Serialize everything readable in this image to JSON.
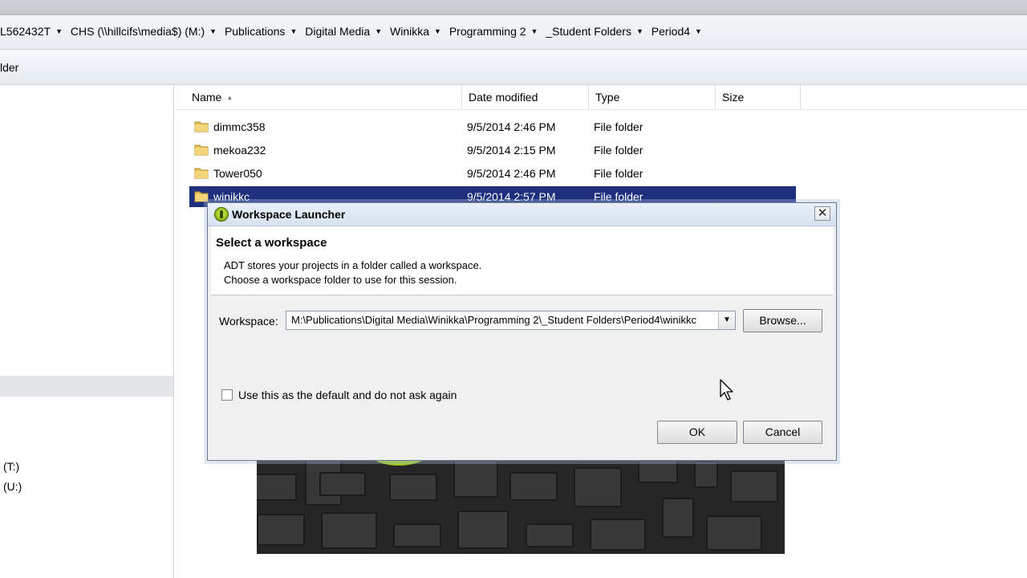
{
  "address_bar": {
    "crumbs": [
      "L562432T",
      "CHS (\\\\hillcifs\\media$) (M:)",
      "Publications",
      "Digital Media",
      "Winikka",
      "Programming 2",
      "_Student Folders",
      "Period4"
    ]
  },
  "toolbar": {
    "partial_label": "lder"
  },
  "nav_pane": {
    "drives": [
      "(T:)",
      "(U:)"
    ]
  },
  "columns": {
    "name": "Name",
    "date_modified": "Date modified",
    "type": "Type",
    "size": "Size"
  },
  "files": [
    {
      "name": "dimmc358",
      "date": "9/5/2014 2:46 PM",
      "type": "File folder",
      "selected": false
    },
    {
      "name": "mekoa232",
      "date": "9/5/2014 2:15 PM",
      "type": "File folder",
      "selected": false
    },
    {
      "name": "Tower050",
      "date": "9/5/2014 2:46 PM",
      "type": "File folder",
      "selected": false
    },
    {
      "name": "winikkc",
      "date": "9/5/2014 2:57 PM",
      "type": "File folder",
      "selected": true
    }
  ],
  "dialog": {
    "title": "Workspace Launcher",
    "close_glyph": "✕",
    "heading": "Select a workspace",
    "description_line1": "ADT stores your projects in a folder called a workspace.",
    "description_line2": "Choose a workspace folder to use for this session.",
    "workspace_label": "Workspace:",
    "workspace_value": "M:\\Publications\\Digital Media\\Winikka\\Programming 2\\_Student Folders\\Period4\\winikkc",
    "browse_label": "Browse...",
    "default_checkbox_label": "Use this as the default and do not ask again",
    "default_checked": false,
    "ok_label": "OK",
    "cancel_label": "Cancel"
  },
  "colors": {
    "selection": "#1d2f7d",
    "folder": "#e8c25a",
    "dialog_bg": "#f0f0f0",
    "adt_icon": "#9cc51f"
  }
}
